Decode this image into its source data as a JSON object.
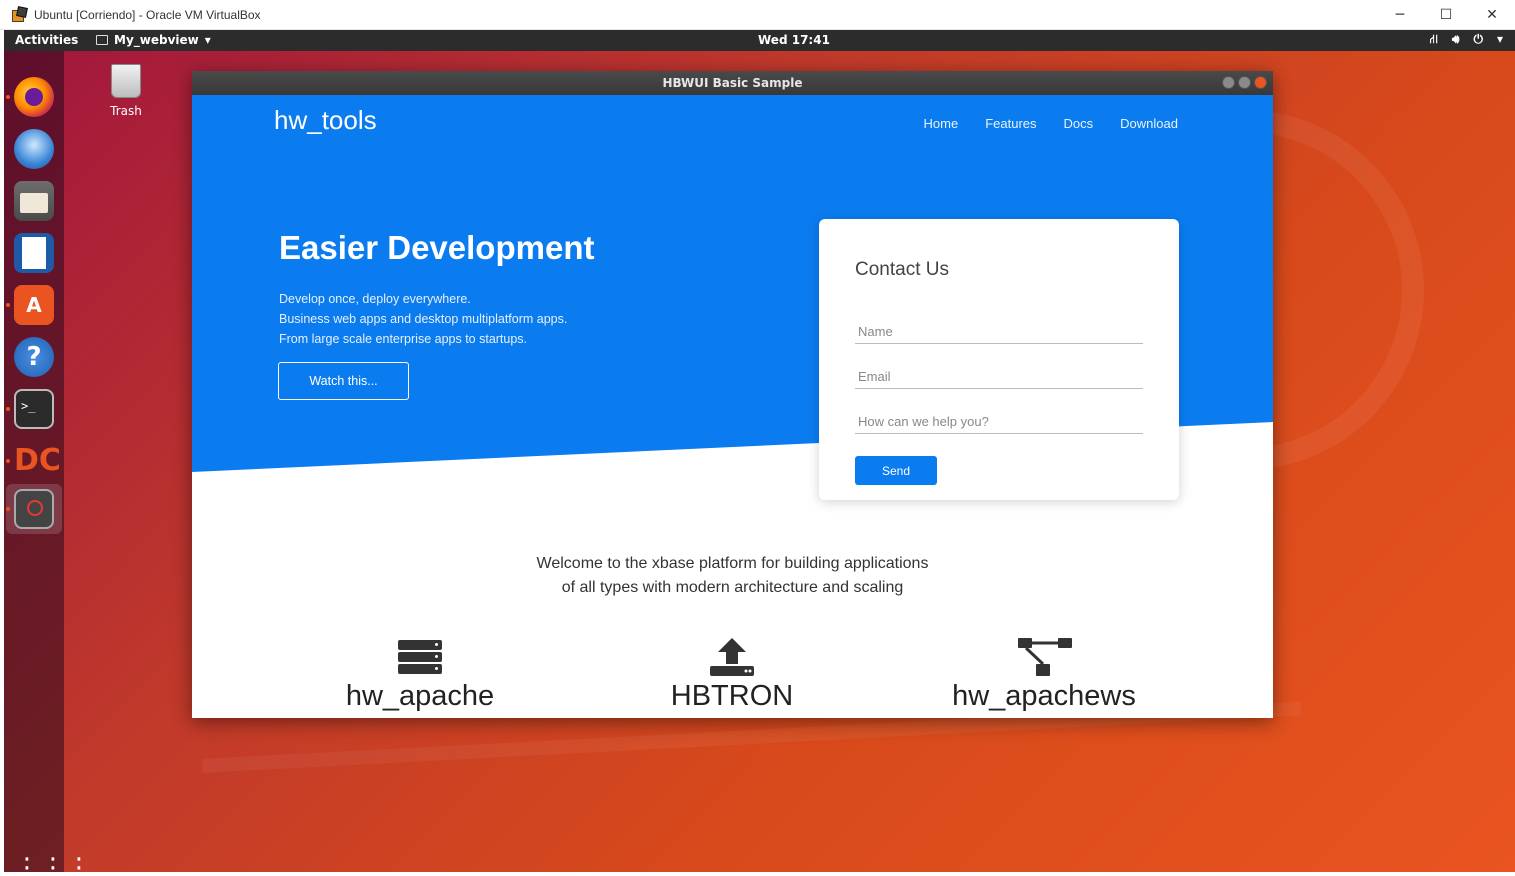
{
  "host": {
    "title": "Ubuntu [Corriendo] - Oracle VM VirtualBox",
    "controls": [
      "─",
      "☐",
      "✕"
    ]
  },
  "topbar": {
    "activities": "Activities",
    "app_name": "My_webview",
    "clock": "Wed 17:41",
    "tray": [
      "network-icon",
      "volume-icon",
      "power-icon"
    ]
  },
  "desktop": {
    "trash_label": "Trash",
    "dock_items": [
      "firefox",
      "thunderbird",
      "files",
      "libreoffice-writer",
      "ubuntu-software",
      "help",
      "terminal",
      "dconf",
      "virtualbox-webview",
      "show-applications"
    ]
  },
  "app": {
    "window_title": "HBWUI Basic Sample",
    "brand": "hw_tools",
    "nav": [
      "Home",
      "Features",
      "Docs",
      "Download"
    ],
    "hero": {
      "title": "Easier Development",
      "lines": [
        "Develop once, deploy everywhere.",
        "Business web apps and desktop multiplatform apps.",
        "From large scale enterprise apps to startups."
      ],
      "cta": "Watch this..."
    },
    "contact": {
      "title": "Contact Us",
      "name_placeholder": "Name",
      "email_placeholder": "Email",
      "help_placeholder": "How can we help you?",
      "send": "Send"
    },
    "welcome": [
      "Welcome to the xbase platform for building applications",
      "of all types with modern architecture and scaling"
    ],
    "features": [
      {
        "icon": "server-icon",
        "name": "hw_apache"
      },
      {
        "icon": "upload-icon",
        "name": "HBTRON"
      },
      {
        "icon": "sitemap-icon",
        "name": "hw_apachews"
      }
    ]
  },
  "colors": {
    "hero_blue": "#0b7cf0",
    "ubuntu_orange": "#e95420",
    "topbar": "#2c2c2c"
  }
}
